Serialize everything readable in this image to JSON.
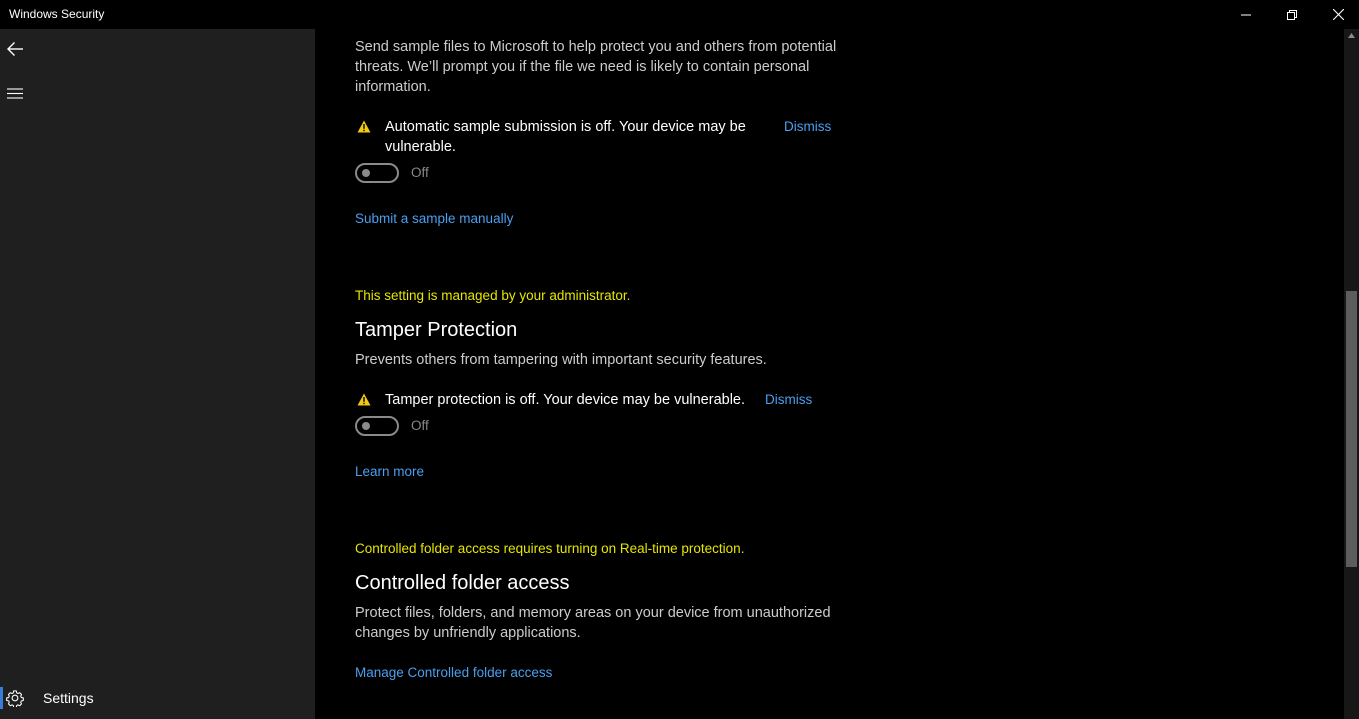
{
  "window": {
    "title": "Windows Security"
  },
  "sidebar": {
    "settings_label": "Settings"
  },
  "sample_submission": {
    "description": "Send sample files to Microsoft to help protect you and others from potential threats. We’ll prompt you if the file we need is likely to contain personal information.",
    "warning": "Automatic sample submission is off. Your device may be vulnerable.",
    "dismiss_label": "Dismiss",
    "toggle_state": "Off",
    "link_label": "Submit a sample manually"
  },
  "tamper_protection": {
    "admin_note": "This setting is managed by your administrator.",
    "title": "Tamper Protection",
    "description": "Prevents others from tampering with important security features.",
    "warning": "Tamper protection is off. Your device may be vulnerable.",
    "dismiss_label": "Dismiss",
    "toggle_state": "Off",
    "link_label": "Learn more"
  },
  "controlled_folder_access": {
    "note": "Controlled folder access requires turning on Real-time protection.",
    "title": "Controlled folder access",
    "description": "Protect files, folders, and memory areas on your device from unauthorized changes by unfriendly applications.",
    "link_label": "Manage Controlled folder access"
  },
  "colors": {
    "link": "#4a9ff0",
    "warning_note": "#e6e600",
    "warning_icon": "#f2c811",
    "accent": "#3a7bd5"
  }
}
